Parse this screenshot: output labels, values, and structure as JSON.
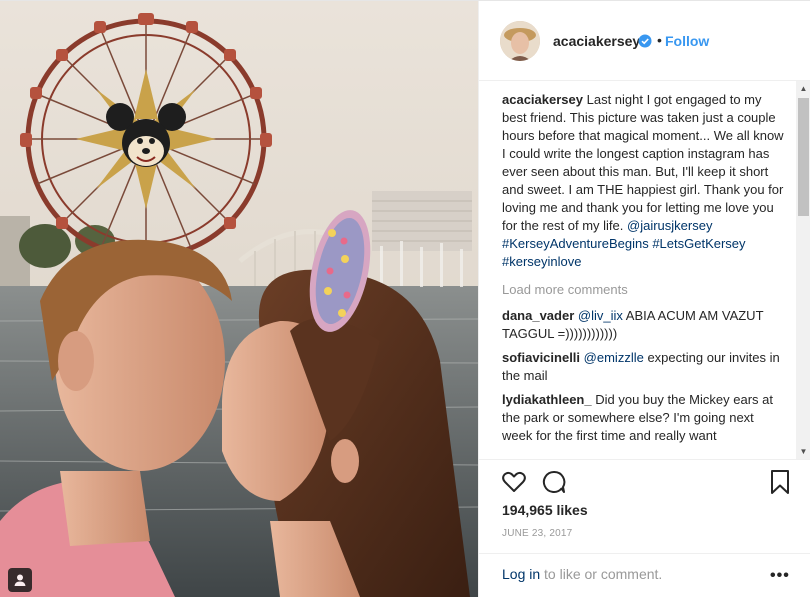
{
  "post": {
    "username": "acaciakersey",
    "follow_label": "Follow",
    "dot": "•",
    "caption": {
      "username": "acaciakersey",
      "text": "Last night I got engaged to my best friend. This picture was taken just a couple hours before that magical moment... We all know I could write the longest caption instagram has ever seen about this man. But, I'll keep it short and sweet. I am THE happiest girl. Thank you for loving me and thank you for letting me love you for the rest of my life.",
      "mention": "@jairusjkersey",
      "hashtags": "#KerseyAdventureBegins #LetsGetKersey #kerseyinlove"
    },
    "load_more": "Load more comments",
    "comments": [
      {
        "username": "dana_vader",
        "mention": "@liv_iix",
        "text": "ABIA ACUM AM VAZUT TAGGUL =))))))))))))"
      },
      {
        "username": "sofiavicinelli",
        "mention": "@emizzlle",
        "text": "expecting our invites in the mail"
      },
      {
        "username": "lydiakathleen_",
        "mention": "",
        "text": "Did you buy the Mickey ears at the park or somewhere else? I'm going next week for the first time and really want"
      }
    ],
    "likes": "194,965 likes",
    "date": "JUNE 23, 2017",
    "login_link": "Log in",
    "login_rest": " to like or comment.",
    "more": "•••"
  },
  "icons": {
    "verified": "verified-badge-icon",
    "heart": "heart-icon",
    "comment": "comment-icon",
    "bookmark": "bookmark-icon",
    "more": "more-options-icon",
    "tag": "user-tag-icon"
  },
  "colors": {
    "link_blue": "#3897f0",
    "text_dark": "#262626",
    "text_muted": "#999999",
    "mention": "#003569"
  }
}
